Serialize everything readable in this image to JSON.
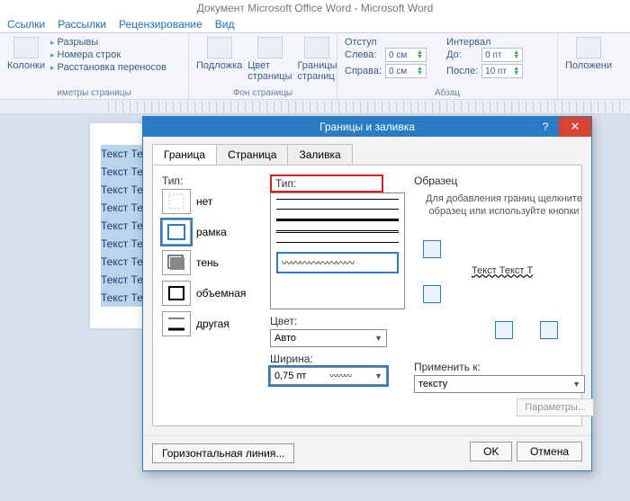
{
  "app_title": "Документ Microsoft Office Word  -  Microsoft Word",
  "menu": [
    "Ссылки",
    "Рассылки",
    "Рецензирование",
    "Вид"
  ],
  "ribbon": {
    "group1": {
      "btn1": "Колонки",
      "list": [
        "Разрывы",
        "Номера строк",
        "Расстановка переносов"
      ],
      "label": "иметры страницы"
    },
    "group2": {
      "b1": "Подложка",
      "b2": "Цвет страницы",
      "b3": "Границы страниц",
      "label": "Фон страницы"
    },
    "indent": {
      "title": "Отступ",
      "left": "Слева:",
      "right": "Справа:",
      "left_v": "0 см",
      "right_v": "0 см"
    },
    "spacing": {
      "title": "Интервал",
      "before": "До:",
      "after": "После:",
      "before_v": "0 пт",
      "after_v": "10 пт"
    },
    "para_label": "Абзац",
    "pos": "Положени"
  },
  "doc_line": "Текст Те",
  "dialog": {
    "title": "Границы и заливка",
    "tabs": [
      "Граница",
      "Страница",
      "Заливка"
    ],
    "type_label": "Тип:",
    "types": [
      "нет",
      "рамка",
      "тень",
      "объемная",
      "другая"
    ],
    "style_label": "Тип:",
    "color_label": "Цвет:",
    "color_value": "Авто",
    "width_label": "Ширина:",
    "width_value": "0,75 пт",
    "preview_label": "Образец",
    "preview_caption": "Для добавления границ щелкните образец или используйте кнопки",
    "preview_text": "Текст Текст Т",
    "apply_label": "Применить к:",
    "apply_value": "тексту",
    "params": "Параметры...",
    "hline": "Горизонтальная линия...",
    "ok": "OK",
    "cancel": "Отмена"
  }
}
